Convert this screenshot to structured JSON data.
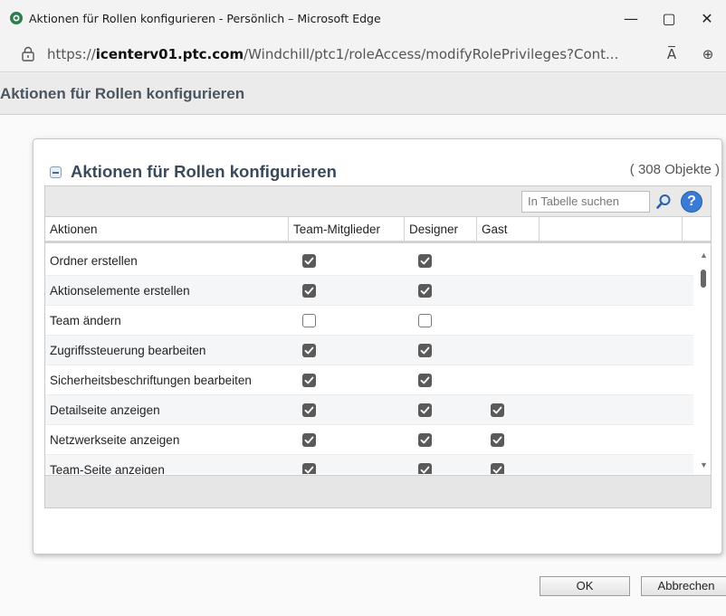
{
  "window": {
    "title": "Aktionen für Rollen konfigurieren - Persönlich – Microsoft Edge",
    "minimize_glyph": "—",
    "maximize_glyph": "▢",
    "close_glyph": "✕"
  },
  "address": {
    "url_prefix": "https://",
    "url_host": "icenterv01.ptc.com",
    "url_path": "/Windchill/ptc1/roleAccess/modifyRolePrivileges?Cont...",
    "read_aloud_glyph": "A̅",
    "zoom_glyph": "⊕"
  },
  "page": {
    "header": "Aktionen für Rollen konfigurieren"
  },
  "panel": {
    "title": "Aktionen für Rollen konfigurieren",
    "count": "( 308 Objekte )"
  },
  "table": {
    "search_placeholder": "In Tabelle suchen",
    "help_glyph": "?",
    "columns": [
      "Aktionen",
      "Team-Mitglieder",
      "Designer",
      "Gast",
      "",
      ""
    ],
    "rows": [
      {
        "action": "Ordner erstellen",
        "team": true,
        "designer": true,
        "gast": null
      },
      {
        "action": "Aktionselemente erstellen",
        "team": true,
        "designer": true,
        "gast": null
      },
      {
        "action": "Team ändern",
        "team": false,
        "designer": false,
        "gast": null
      },
      {
        "action": "Zugriffssteuerung bearbeiten",
        "team": true,
        "designer": true,
        "gast": null
      },
      {
        "action": "Sicherheitsbeschriftungen bearbeiten",
        "team": true,
        "designer": true,
        "gast": null
      },
      {
        "action": "Detailseite anzeigen",
        "team": true,
        "designer": true,
        "gast": true
      },
      {
        "action": "Netzwerkseite anzeigen",
        "team": true,
        "designer": true,
        "gast": true
      },
      {
        "action": "Team-Seite anzeigen",
        "team": true,
        "designer": true,
        "gast": true
      }
    ]
  },
  "buttons": {
    "ok": "OK",
    "cancel": "Abbrechen"
  },
  "colors": {
    "checkbox_checked": "#5a5a5a",
    "help_blue": "#3a7bd5",
    "header_text": "#4a5560"
  }
}
